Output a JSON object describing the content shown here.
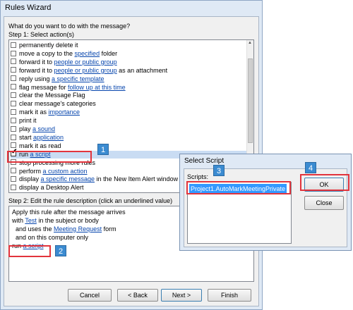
{
  "window": {
    "title": "Rules Wizard"
  },
  "question": "What do you want to do with the message?",
  "step1": {
    "label": "Step 1: Select action(s)",
    "actions": [
      {
        "pre": "permanently delete it",
        "link": "",
        "post": "",
        "checked": false
      },
      {
        "pre": "move a copy to the ",
        "link": "specified",
        "post": " folder",
        "checked": false
      },
      {
        "pre": "forward it to ",
        "link": "people or public group",
        "post": "",
        "checked": false
      },
      {
        "pre": "forward it to ",
        "link": "people or public group",
        "post": " as an attachment",
        "checked": false
      },
      {
        "pre": "reply using ",
        "link": "a specific template",
        "post": "",
        "checked": false
      },
      {
        "pre": "flag message for ",
        "link": "follow up at this time",
        "post": "",
        "checked": false
      },
      {
        "pre": "clear the Message Flag",
        "link": "",
        "post": "",
        "checked": false
      },
      {
        "pre": "clear message's categories",
        "link": "",
        "post": "",
        "checked": false
      },
      {
        "pre": "mark it as ",
        "link": "importance",
        "post": "",
        "checked": false
      },
      {
        "pre": "print it",
        "link": "",
        "post": "",
        "checked": false
      },
      {
        "pre": "play ",
        "link": "a sound",
        "post": "",
        "checked": false
      },
      {
        "pre": "start ",
        "link": "application",
        "post": "",
        "checked": false
      },
      {
        "pre": "mark it as read",
        "link": "",
        "post": "",
        "checked": false
      },
      {
        "pre": "run ",
        "link": "a script",
        "post": "",
        "checked": true
      },
      {
        "pre": "stop processing more rules",
        "link": "",
        "post": "",
        "checked": false
      },
      {
        "pre": "perform ",
        "link": "a custom action",
        "post": "",
        "checked": false
      },
      {
        "pre": "display ",
        "link": "a specific message",
        "post": " in the New Item Alert window",
        "checked": false
      },
      {
        "pre": "display a Desktop Alert",
        "link": "",
        "post": "",
        "checked": false
      }
    ]
  },
  "step2": {
    "label": "Step 2: Edit the rule description (click an underlined value)",
    "lines": [
      {
        "pre": "Apply this rule after the message arrives",
        "link": "",
        "post": ""
      },
      {
        "pre": "with ",
        "link": "Test",
        "post": " in the subject or body"
      },
      {
        "pre": "  and uses the ",
        "link": "Meeting Request",
        "post": " form"
      },
      {
        "pre": "  and on this computer only",
        "link": "",
        "post": ""
      },
      {
        "pre": "run ",
        "link": "a script",
        "post": ""
      }
    ]
  },
  "buttons": {
    "cancel": "Cancel",
    "back": "< Back",
    "next": "Next >",
    "finish": "Finish"
  },
  "select_script": {
    "title": "Select Script",
    "scripts_label": "Scripts:",
    "selected": "Project1.AutoMarkMeetingPrivate",
    "ok": "OK",
    "close": "Close"
  },
  "callouts": [
    "1",
    "2",
    "3",
    "4"
  ],
  "colors": {
    "highlight": "#e2343c",
    "callout": "#3b8bd1",
    "link": "#0645ad",
    "selection": "#3399ff"
  }
}
